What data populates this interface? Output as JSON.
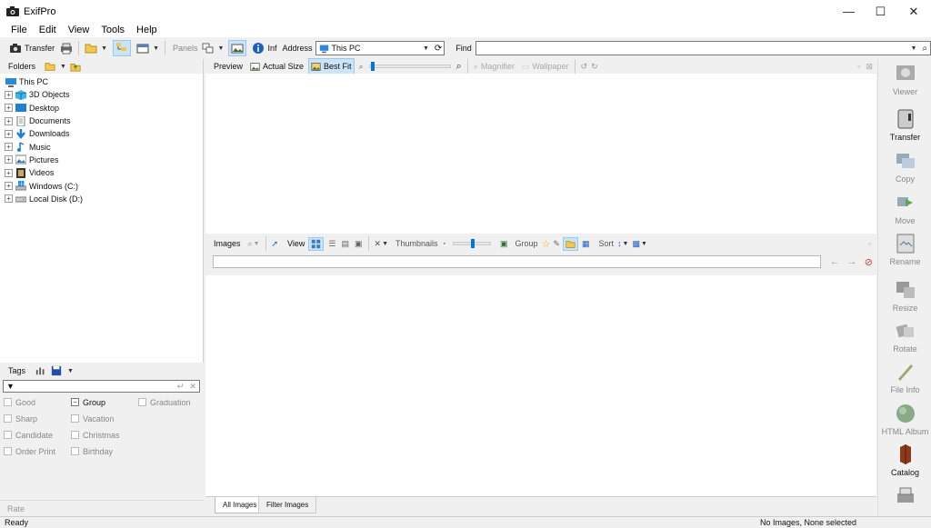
{
  "window": {
    "title": "ExifPro",
    "controls": [
      "—",
      "☐",
      "✕"
    ]
  },
  "menu": [
    "File",
    "Edit",
    "View",
    "Tools",
    "Help"
  ],
  "toolbar": {
    "transfer": "Transfer",
    "panels": "Panels",
    "info": "Info",
    "address_label": "Address",
    "address_value": "This PC",
    "find_label": "Find"
  },
  "folders": {
    "header": "Folders",
    "items": [
      "This PC",
      "3D Objects",
      "Desktop",
      "Documents",
      "Downloads",
      "Music",
      "Pictures",
      "Videos",
      "Windows (C:)",
      "Local Disk (D:)"
    ]
  },
  "tags": {
    "header": "Tags",
    "items": [
      "Good",
      "Group",
      "Graduation",
      "Sharp",
      "Vacation",
      "Candidate",
      "Christmas",
      "Order Print",
      "Birthday"
    ],
    "rate": "Rate"
  },
  "preview_toolbar": {
    "preview": "Preview",
    "actual_size": "Actual Size",
    "best_fit": "Best Fit",
    "zoom_level": 0.02,
    "magnifier": "Magnifier",
    "wallpaper": "Wallpaper"
  },
  "images_toolbar": {
    "images": "Images",
    "view": "View",
    "thumbnails": "Thumbnails",
    "thumb_size": 0.5,
    "group": "Group",
    "sort": "Sort"
  },
  "tabs": [
    "All Images",
    "Filter Images"
  ],
  "sidebar": [
    "Viewer",
    "Transfer",
    "Copy",
    "Move",
    "Rename",
    "Resize",
    "Rotate",
    "File Info",
    "HTML Album",
    "Catalog"
  ],
  "status": {
    "left": "Ready",
    "right": "No Images, None selected"
  }
}
